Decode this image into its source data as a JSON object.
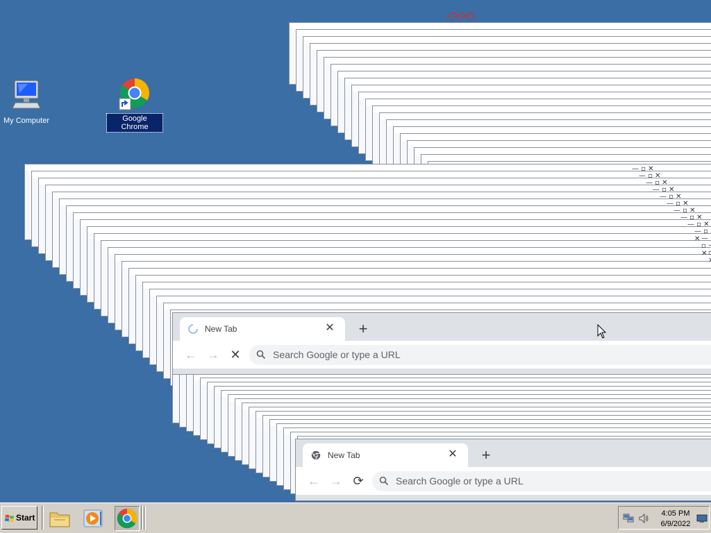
{
  "desktop": {
    "icons": [
      {
        "label": "My Computer",
        "icon": "my-computer-icon"
      },
      {
        "label": "Google Chrome",
        "icon": "chrome-icon",
        "selected": true
      }
    ]
  },
  "windows": [
    {
      "tab_title": "New Tab",
      "tab_state": "loading",
      "reload_or_stop": "stop",
      "omnibox_placeholder": "Search Google or type a URL"
    },
    {
      "tab_title": "New Tab",
      "tab_state": "loaded",
      "reload_or_stop": "reload",
      "omnibox_placeholder": "Search Google or type a URL"
    }
  ],
  "taskbar": {
    "start_label": "Start",
    "quick_launch": [
      "file-explorer-icon",
      "media-player-icon",
      "chrome-icon"
    ],
    "tray_icons": [
      "network-icon",
      "volume-icon",
      "show-desktop-icon"
    ],
    "clock": {
      "time": "4:05 PM",
      "date": "6/9/2022"
    }
  },
  "colors": {
    "desktop_bg": "#3a6ea5",
    "taskbar_bg": "#d4d0c8",
    "selection": "#0a246a",
    "chrome_tabstrip": "#dee1e6"
  }
}
